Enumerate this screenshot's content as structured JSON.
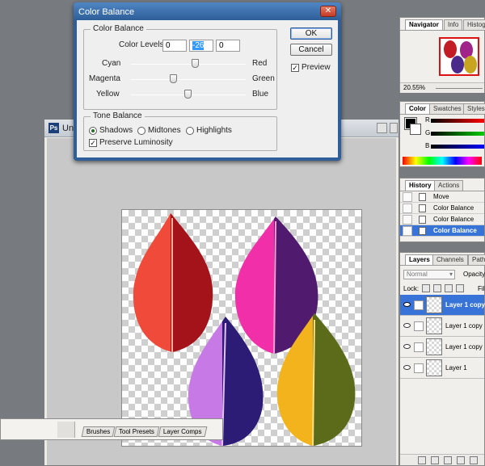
{
  "dialog": {
    "title": "Color Balance",
    "color_balance_group": "Color Balance",
    "color_levels_label": "Color Levels:",
    "levels": [
      "0",
      "-26",
      "0"
    ],
    "sliders": [
      {
        "left": "Cyan",
        "right": "Red",
        "level": 0.56
      },
      {
        "left": "Magenta",
        "right": "Green",
        "level": 0.37
      },
      {
        "left": "Yellow",
        "right": "Blue",
        "level": 0.5
      }
    ],
    "tone_group": "Tone Balance",
    "tones": [
      {
        "label": "Shadows",
        "selected": true
      },
      {
        "label": "Midtones",
        "selected": false
      },
      {
        "label": "Highlights",
        "selected": false
      }
    ],
    "preserve_luminosity": "Preserve Luminosity",
    "ok": "OK",
    "cancel": "Cancel",
    "preview": "Preview"
  },
  "document": {
    "title_fragment": "Unt"
  },
  "navigator": {
    "tabs": [
      "Navigator",
      "Info",
      "Histogra"
    ],
    "zoom": "20.55%"
  },
  "color_panel": {
    "tabs": [
      "Color",
      "Swatches",
      "Styles"
    ],
    "channels": [
      "R",
      "G",
      "B"
    ]
  },
  "history": {
    "tabs": [
      "History",
      "Actions"
    ],
    "items": [
      {
        "label": "Move",
        "selected": false
      },
      {
        "label": "Color Balance",
        "selected": false
      },
      {
        "label": "Color Balance",
        "selected": false
      },
      {
        "label": "Color Balance",
        "selected": true
      }
    ]
  },
  "layers": {
    "tabs": [
      "Layers",
      "Channels",
      "Paths"
    ],
    "blend_mode": "Normal",
    "opacity_label": "Opacity",
    "lock_label": "Lock:",
    "fill_label": "Fil",
    "items": [
      {
        "label": "Layer 1 copy",
        "selected": true
      },
      {
        "label": "Layer 1 copy",
        "selected": false
      },
      {
        "label": "Layer 1 copy",
        "selected": false
      },
      {
        "label": "Layer 1",
        "selected": false
      }
    ]
  },
  "dock": {
    "tabs": [
      "Brushes",
      "Tool Presets",
      "Layer Comps"
    ]
  },
  "colors": {
    "selection": "#3874d8",
    "title_bar": "#2f5f9a"
  }
}
